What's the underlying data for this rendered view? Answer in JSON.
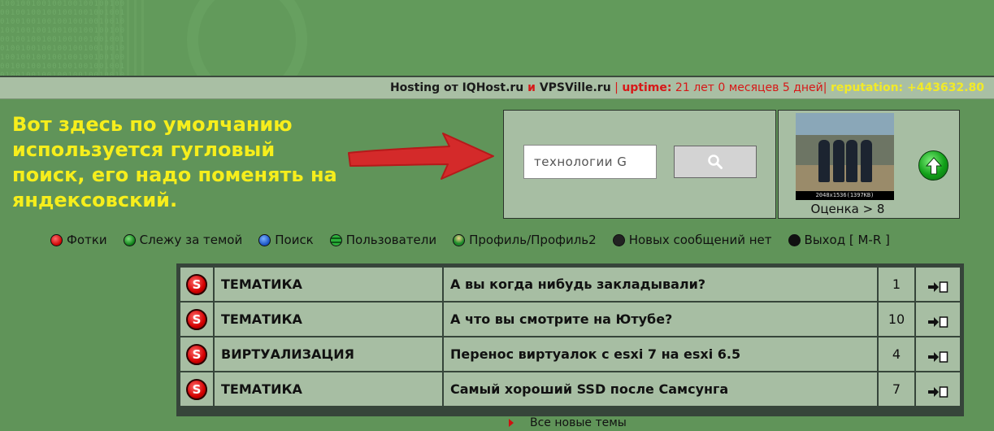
{
  "infobar": {
    "hosting_prefix": "Hosting от ",
    "host1": "IQHost.ru",
    "and": " и ",
    "host2": "VPSVille.ru",
    "sep1": " | ",
    "uptime_label": "uptime:",
    "uptime_value": " 21 лет 0 месяцев 5 дней",
    "sep2": "| ",
    "reputation": "reputation: +443632.80"
  },
  "annotation": {
    "text": "Вот здесь по умолчанию используется гугловый поиск, его надо поменять на яндексовский."
  },
  "search": {
    "value": "технологии G"
  },
  "photo": {
    "caption": "2048x1536(1397KB)",
    "rating": "Оценка > 8"
  },
  "nav": [
    {
      "label": "Фотки"
    },
    {
      "label": "Слежу за темой"
    },
    {
      "label": "Поиск"
    },
    {
      "label": "Пользователи"
    },
    {
      "label": "Профиль/Профиль2"
    },
    {
      "label": "Новых сообщений нет"
    },
    {
      "label": "Выход [ M-R ]"
    }
  ],
  "topics": [
    {
      "category": "ТЕМАТИКА",
      "title": "А вы когда нибудь закладывали?",
      "count": "1"
    },
    {
      "category": "ТЕМАТИКА",
      "title": "А что вы смотрите на Ютубе?",
      "count": "10"
    },
    {
      "category": "ВИРТУАЛИЗАЦИЯ",
      "title": "Перенос виртуалок с esxi 7 на esxi 6.5",
      "count": "4"
    },
    {
      "category": "ТЕМАТИКА",
      "title": "Самый хороший SSD после Самсунга",
      "count": "7"
    }
  ],
  "all_new": "Все новые темы",
  "icons": {
    "search": "search-icon",
    "go": "green-up-arrow-icon",
    "topic": "red-s-icon",
    "goto": "goto-new-post-icon"
  }
}
